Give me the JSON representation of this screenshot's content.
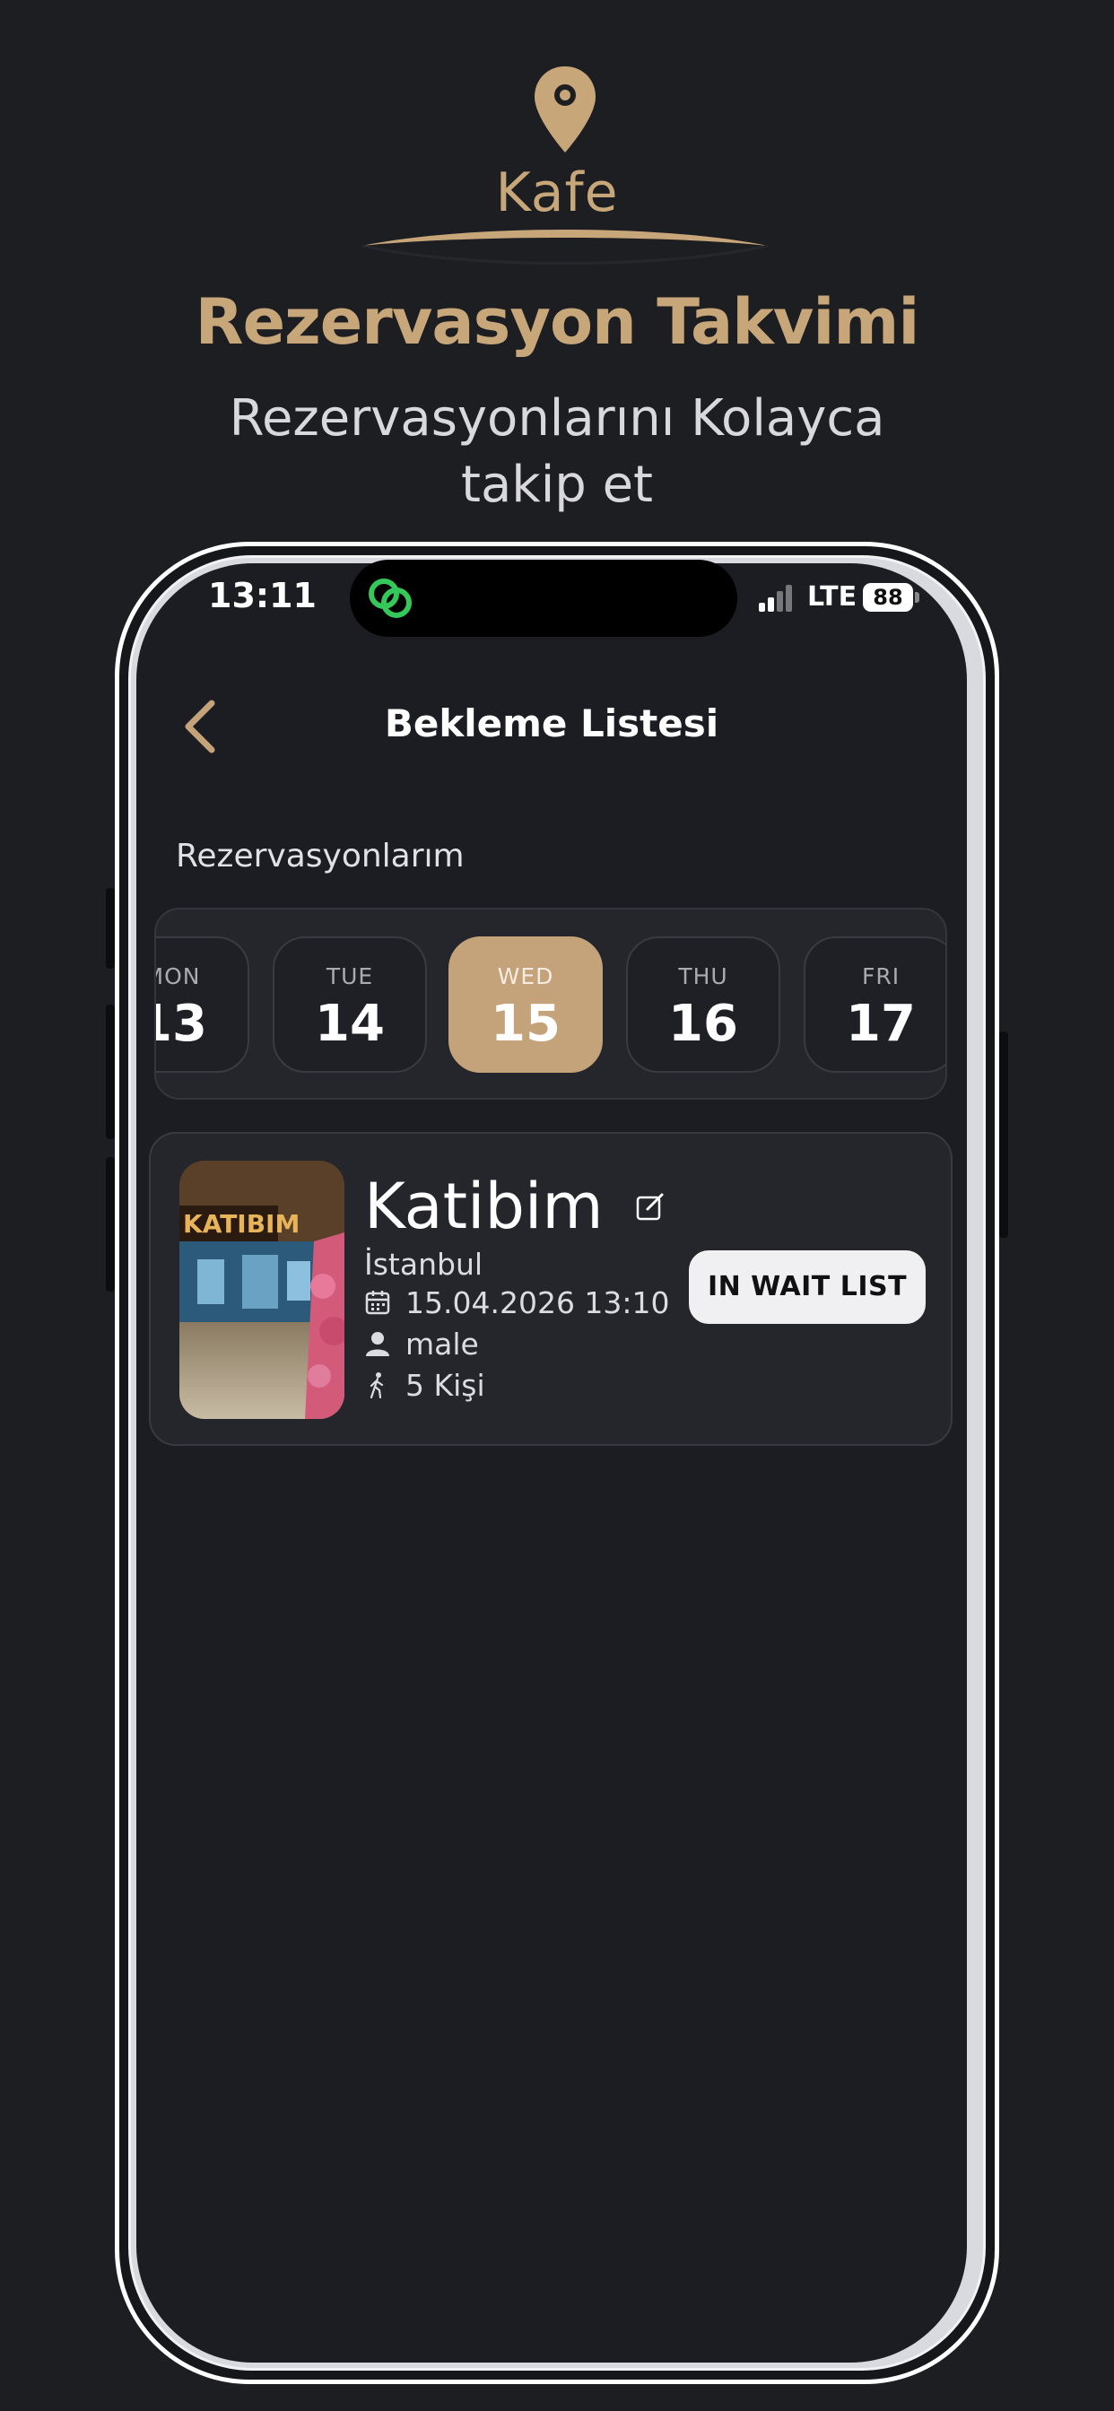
{
  "promo": {
    "brand": "Kafe",
    "title": "Rezervasyon Takvimi",
    "subtitle": "Rezervasyonlarını Kolayca takip et"
  },
  "status_bar": {
    "time": "13:11",
    "network": "LTE",
    "battery": "88"
  },
  "nav": {
    "title": "Bekleme Listesi"
  },
  "section": {
    "label": "Rezervasyonlarım"
  },
  "days": [
    {
      "name": "MON",
      "num": "13",
      "selected": false
    },
    {
      "name": "TUE",
      "num": "14",
      "selected": false
    },
    {
      "name": "WED",
      "num": "15",
      "selected": true
    },
    {
      "name": "THU",
      "num": "16",
      "selected": false
    },
    {
      "name": "FRI",
      "num": "17",
      "selected": false
    }
  ],
  "reservation": {
    "name": "Katibim",
    "city": "İstanbul",
    "datetime": "15.04.2026 13:10",
    "gender": "male",
    "guests": "5 Kişi",
    "status_button": "IN WAIT LIST",
    "image_sign": "KATIBIM"
  },
  "colors": {
    "accent": "#c4a27a",
    "background": "#1c1d22",
    "card": "#24262c"
  }
}
